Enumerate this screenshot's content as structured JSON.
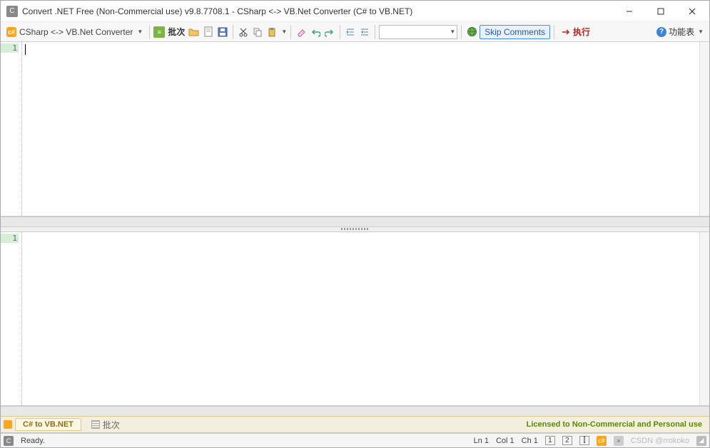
{
  "window": {
    "title": "Convert .NET Free (Non-Commercial use) v9.8.7708.1 - CSharp <-> VB.Net Converter (C# to VB.NET)"
  },
  "toolbar": {
    "converter_label": "CSharp <-> VB.Net Converter",
    "batch_label": "批次",
    "skip_comments": "Skip Comments",
    "execute": "执行",
    "functions": "功能表"
  },
  "editor": {
    "top_line": "1",
    "bottom_line": "1",
    "content_top": "",
    "content_bottom": ""
  },
  "tabs": {
    "tab1": "C# to VB.NET",
    "tab2": "批次"
  },
  "license": "Licensed to Non-Commercial and Personal use",
  "status": {
    "ready": "Ready.",
    "ln": "Ln 1",
    "col": "Col 1",
    "ch": "Ch 1",
    "panel1": "1",
    "panel2": "2",
    "watermark": "CSDN @rrokoko"
  }
}
